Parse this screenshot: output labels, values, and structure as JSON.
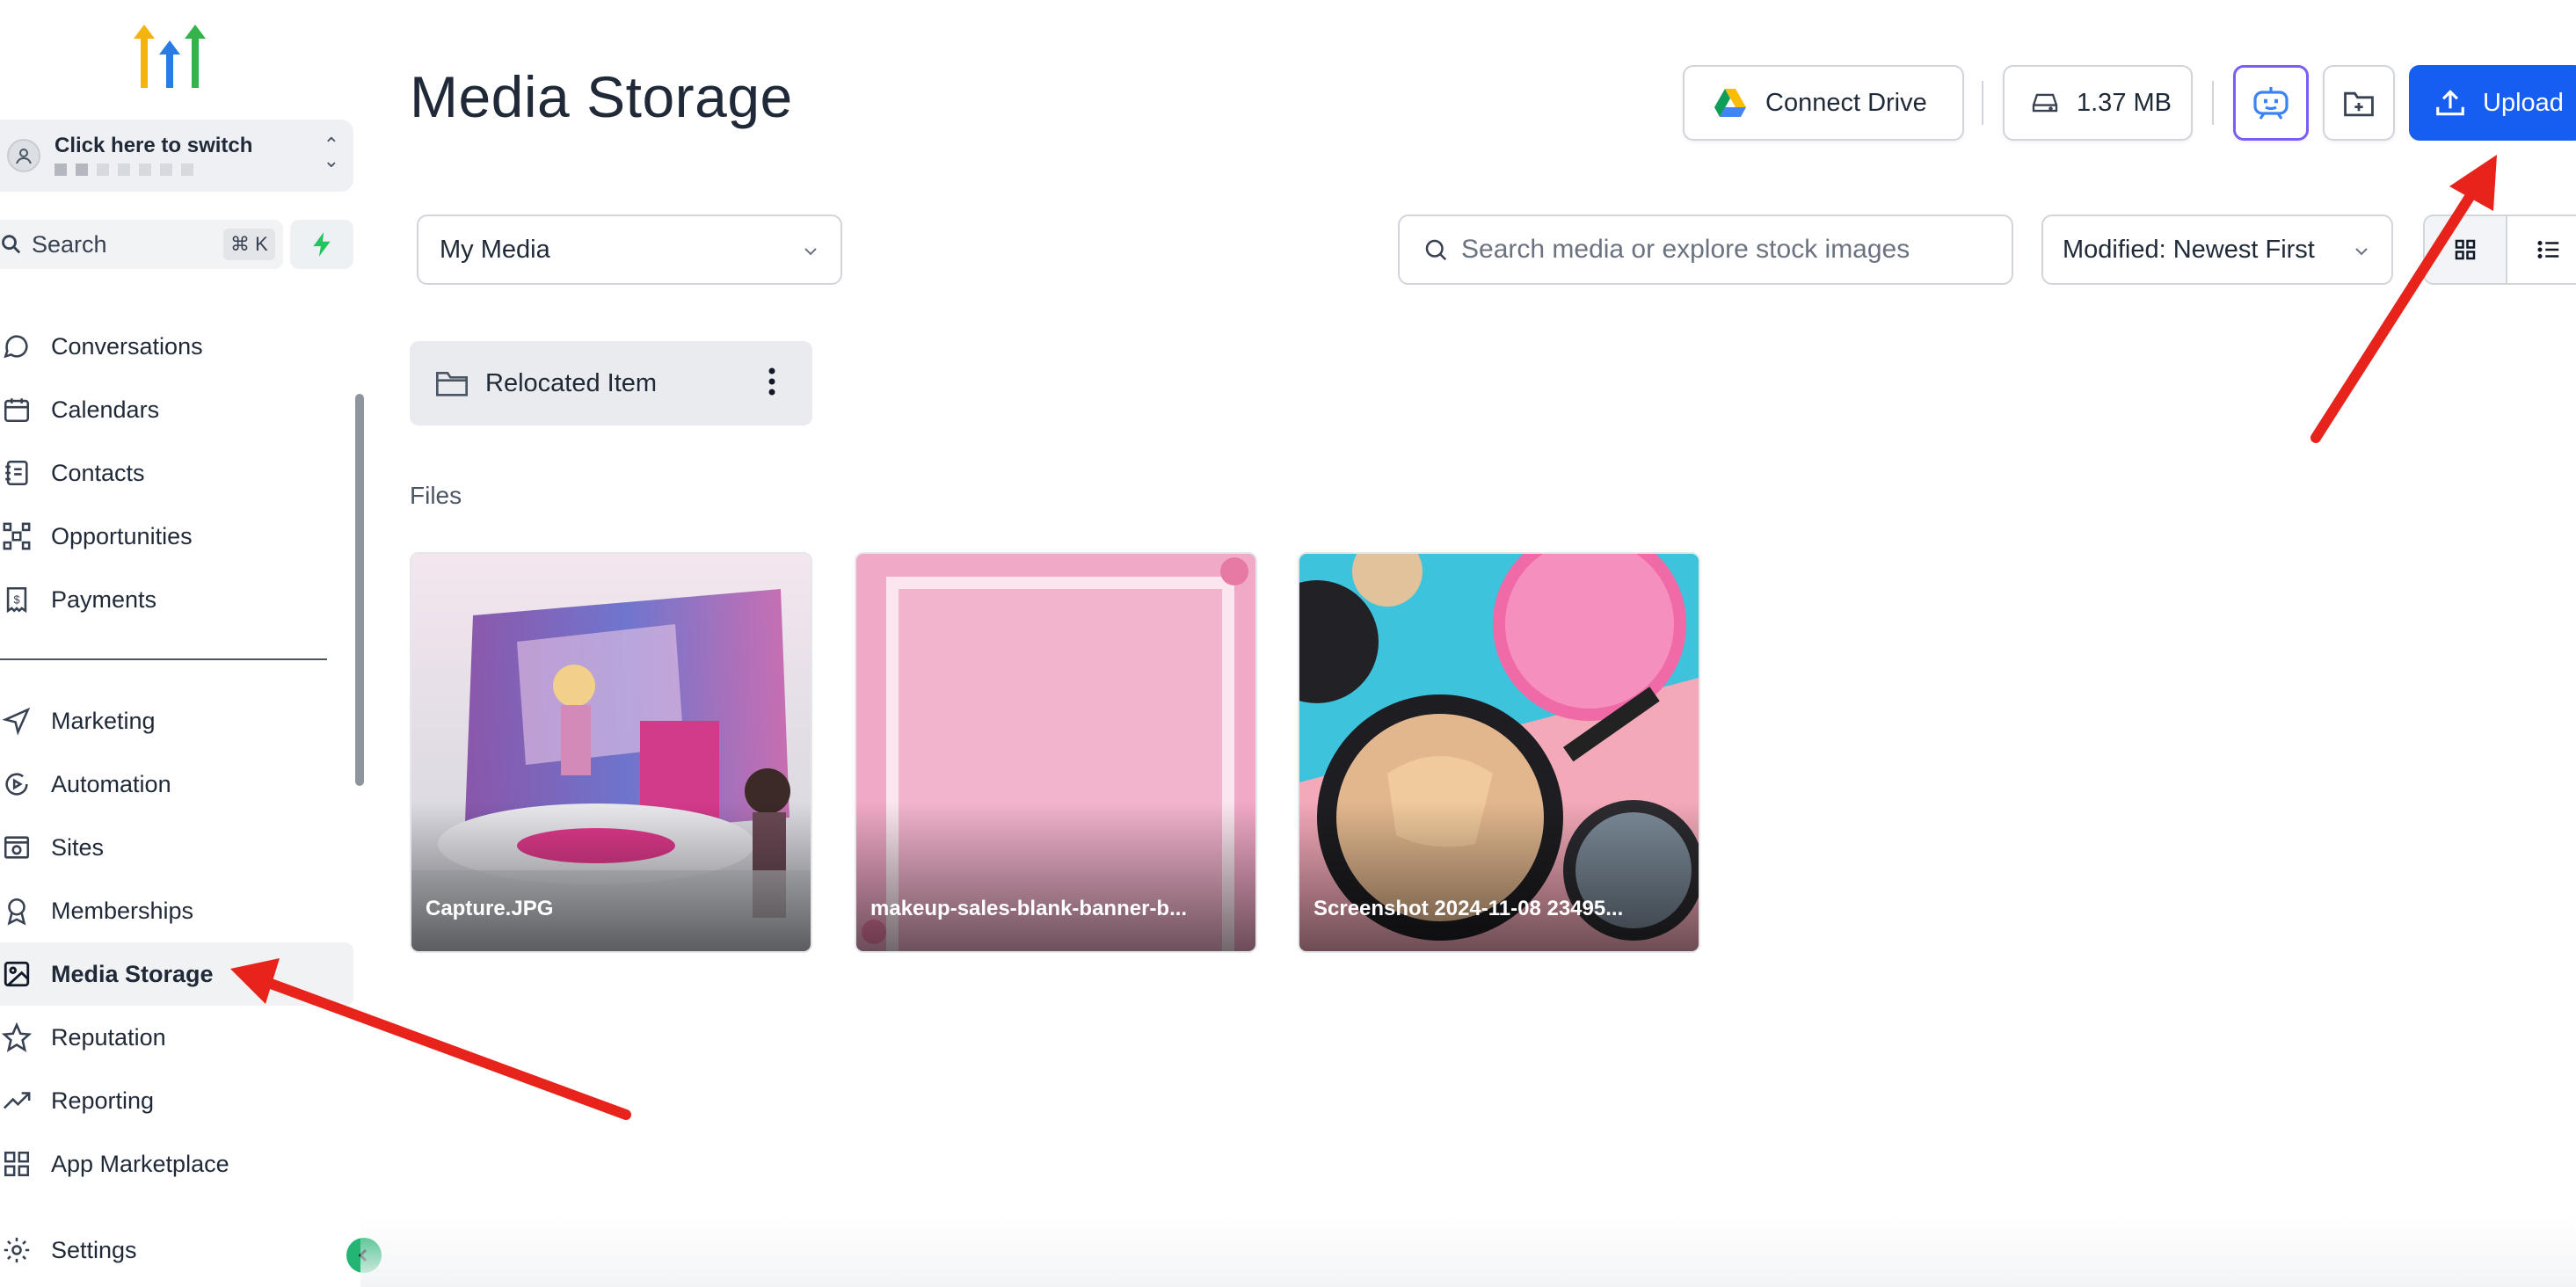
{
  "colors": {
    "primary": "#155eef",
    "sidebar_active_bg": "#f1f2f4",
    "annotation_arrow": "#e8231c",
    "collapse_button": "#22b573",
    "ai_button_border": "#7c5cf6"
  },
  "sidebar": {
    "switcher": {
      "title": "Click here to switch"
    },
    "search": {
      "label": "Search",
      "shortcut": "⌘ K"
    },
    "items": [
      {
        "label": "Conversations",
        "icon": "chat-bubble-icon"
      },
      {
        "label": "Calendars",
        "icon": "calendar-icon"
      },
      {
        "label": "Contacts",
        "icon": "contacts-book-icon"
      },
      {
        "label": "Opportunities",
        "icon": "opportunities-icon"
      },
      {
        "label": "Payments",
        "icon": "payments-icon"
      },
      {
        "label": "Marketing",
        "icon": "send-icon"
      },
      {
        "label": "Automation",
        "icon": "automation-icon"
      },
      {
        "label": "Sites",
        "icon": "sites-icon"
      },
      {
        "label": "Memberships",
        "icon": "badge-icon"
      },
      {
        "label": "Media Storage",
        "icon": "image-icon",
        "active": true
      },
      {
        "label": "Reputation",
        "icon": "star-icon"
      },
      {
        "label": "Reporting",
        "icon": "trend-up-icon"
      },
      {
        "label": "App Marketplace",
        "icon": "grid-icon"
      },
      {
        "label": "Settings",
        "icon": "gear-icon"
      }
    ]
  },
  "header": {
    "title": "Media Storage",
    "connect_drive": "Connect Drive",
    "storage_used": "1.37 MB",
    "upload": "Upload"
  },
  "filters": {
    "source_select": "My Media",
    "search_placeholder": "Search media or explore stock images",
    "sort_select": "Modified: Newest First",
    "view_mode": "grid"
  },
  "folders": [
    {
      "name": "Relocated Item"
    }
  ],
  "files_section_label": "Files",
  "files": [
    {
      "name": "Capture.JPG"
    },
    {
      "name": "makeup-sales-blank-banner-b..."
    },
    {
      "name": "Screenshot 2024-11-08 23495..."
    }
  ]
}
